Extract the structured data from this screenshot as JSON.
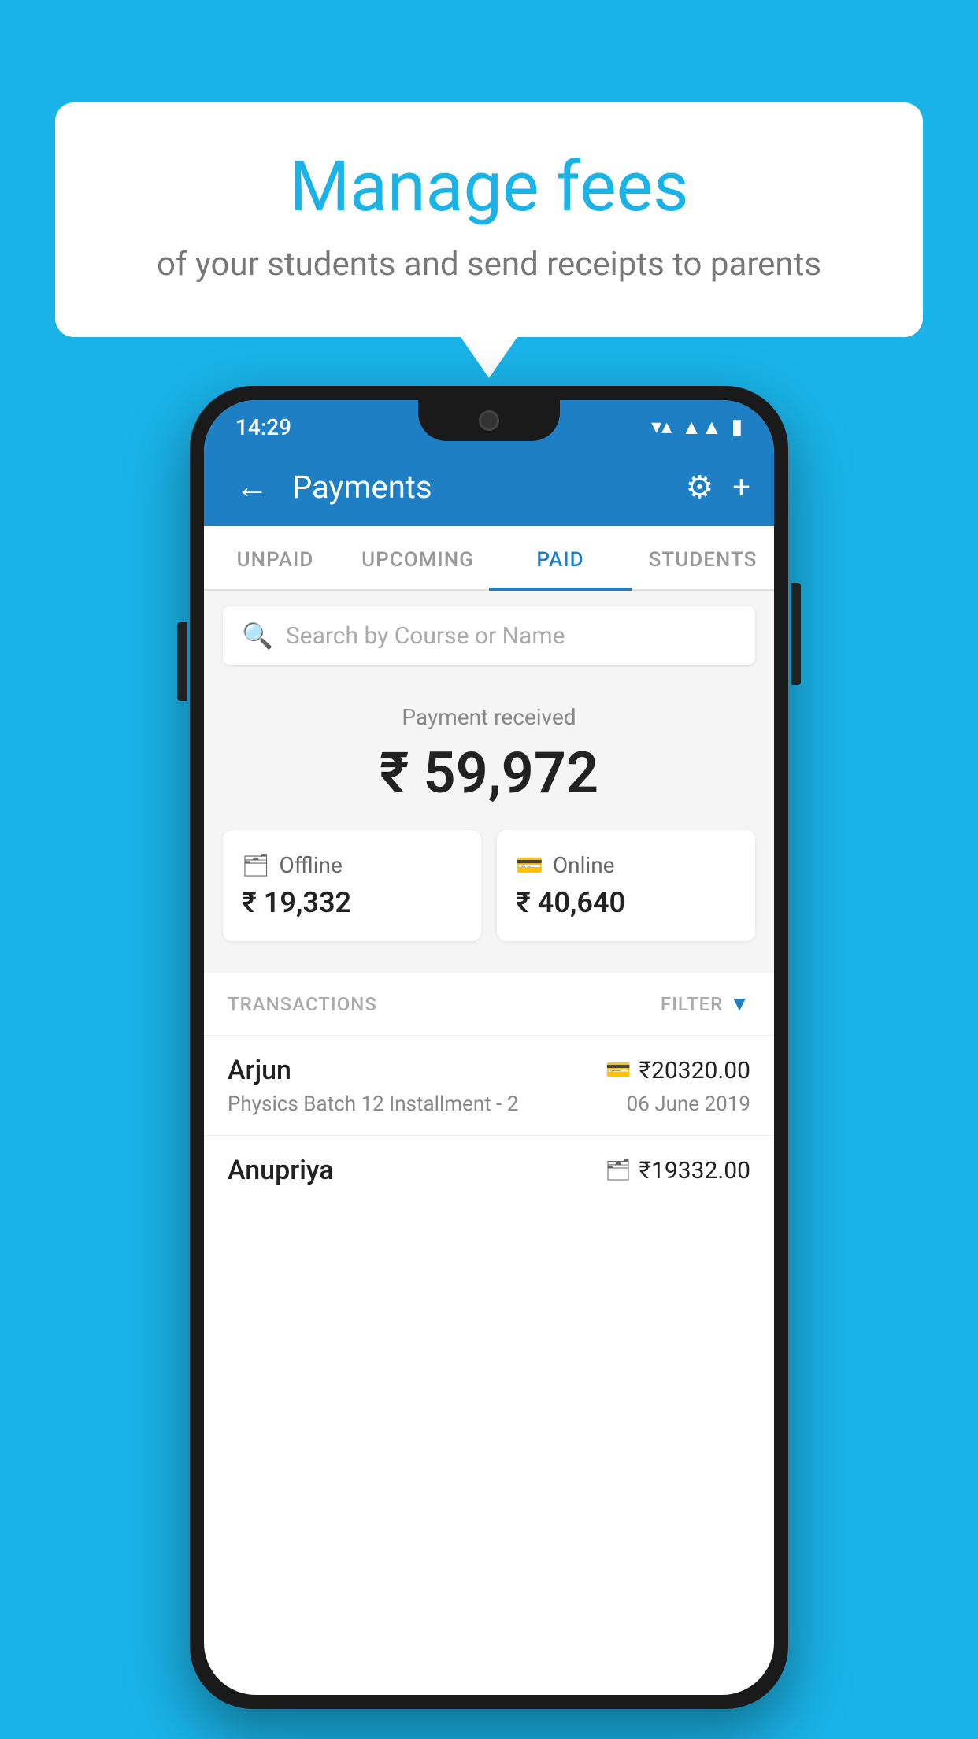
{
  "page": {
    "background_color": "#1ab3e8"
  },
  "speech_bubble": {
    "title": "Manage fees",
    "subtitle": "of your students and send receipts to parents"
  },
  "phone": {
    "status_bar": {
      "time": "14:29",
      "icons": [
        "wifi",
        "signal",
        "battery"
      ]
    },
    "header": {
      "back_label": "←",
      "title": "Payments",
      "gear_icon": "⚙",
      "plus_icon": "+"
    },
    "tabs": [
      {
        "label": "UNPAID",
        "active": false
      },
      {
        "label": "UPCOMING",
        "active": false
      },
      {
        "label": "PAID",
        "active": true
      },
      {
        "label": "STUDENTS",
        "active": false
      }
    ],
    "search": {
      "placeholder": "Search by Course or Name"
    },
    "payment_summary": {
      "label": "Payment received",
      "amount": "₹ 59,972",
      "cards": [
        {
          "type": "Offline",
          "amount": "₹ 19,332",
          "icon": "💵"
        },
        {
          "type": "Online",
          "amount": "₹ 40,640",
          "icon": "💳"
        }
      ]
    },
    "transactions": {
      "header_label": "TRANSACTIONS",
      "filter_label": "FILTER",
      "rows": [
        {
          "name": "Arjun",
          "course": "Physics Batch 12 Installment - 2",
          "amount": "₹20320.00",
          "date": "06 June 2019",
          "method_icon": "💳"
        },
        {
          "name": "Anupriya",
          "course": "",
          "amount": "₹19332.00",
          "date": "",
          "method_icon": "💵"
        }
      ]
    }
  }
}
